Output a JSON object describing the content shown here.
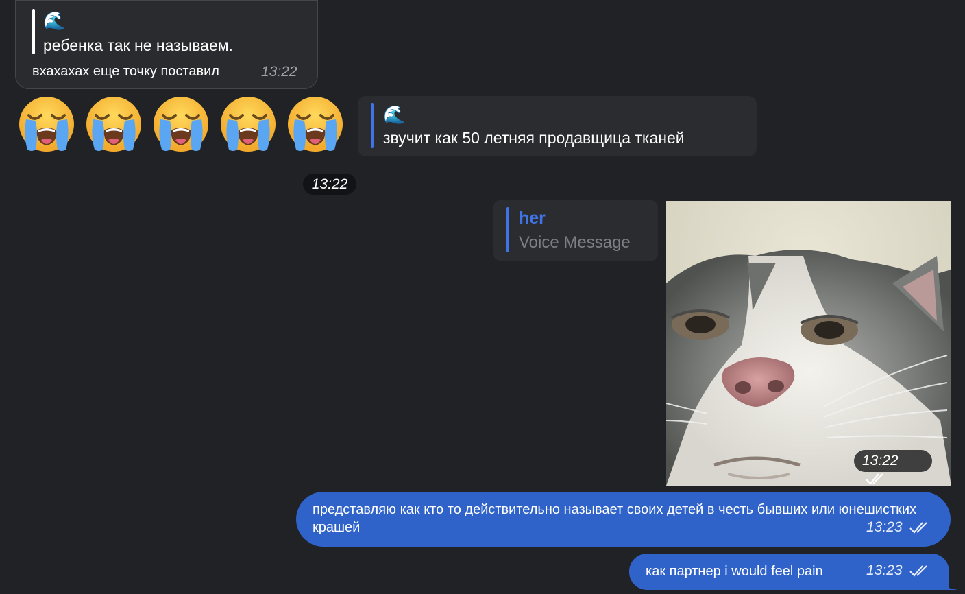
{
  "messages": {
    "incoming_1": {
      "quote_icon": "wave-emoji",
      "quote_emoji": "🌊",
      "quote_text": "ребенка так не называем.",
      "text": "вхахахах еще точку поставил",
      "time": "13:22"
    },
    "emoji_row": {
      "icon": "loudly-crying-face-emoji",
      "count": 5
    },
    "reply_card": {
      "quote_emoji": "🌊",
      "text": "звучит как 50 летняя продавщица тканей"
    },
    "separator_time": "13:22",
    "voice_reply": {
      "name": "her",
      "label": "Voice Message"
    },
    "photo": {
      "description_icon": "cat-face-photo",
      "time": "13:22"
    },
    "outgoing_1": {
      "text": "представляю как кто то действительно называет своих детей в честь бывших или юнешистких крашей",
      "time": "13:23"
    },
    "outgoing_2": {
      "text": "как партнер i would feel pain",
      "time": "13:23"
    }
  },
  "colors": {
    "background": "#202226",
    "bubble_in": "#2a2b2f",
    "bubble_out": "#2f63c9",
    "accent": "#3f73e6"
  }
}
